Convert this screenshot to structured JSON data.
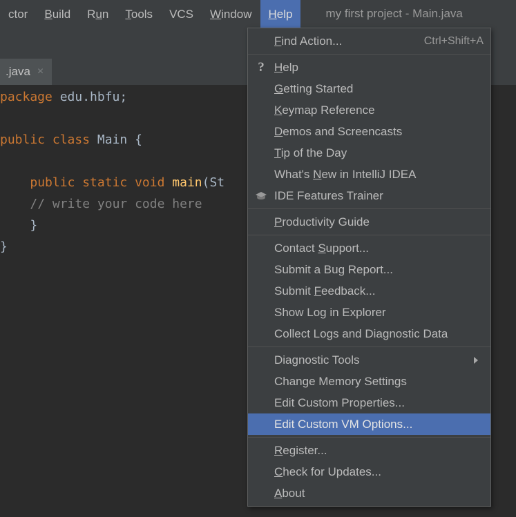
{
  "window": {
    "title": "my first project - Main.java"
  },
  "menubar": {
    "items": [
      {
        "label": "ctor",
        "mnemonic": "",
        "active": false
      },
      {
        "label": "Build",
        "mnemonic": "B",
        "active": false
      },
      {
        "label": "Run",
        "mnemonic": "u",
        "active": false
      },
      {
        "label": "Tools",
        "mnemonic": "T",
        "active": false
      },
      {
        "label": "VCS",
        "mnemonic": "",
        "active": false
      },
      {
        "label": "Window",
        "mnemonic": "W",
        "active": false
      },
      {
        "label": "Help",
        "mnemonic": "H",
        "active": true
      }
    ]
  },
  "editor": {
    "tab": {
      "label": ".java",
      "close_icon": "close-icon",
      "close_glyph": "×"
    },
    "code_lines": [
      [
        {
          "t": "package ",
          "c": "kw"
        },
        {
          "t": "edu.hbfu;",
          "c": "plain"
        }
      ],
      [],
      [
        {
          "t": "public class ",
          "c": "kw"
        },
        {
          "t": "Main {",
          "c": "plain"
        }
      ],
      [],
      [
        {
          "t": "    ",
          "c": "plain"
        },
        {
          "t": "public static void ",
          "c": "kw"
        },
        {
          "t": "main",
          "c": "mth"
        },
        {
          "t": "(St",
          "c": "plain"
        }
      ],
      [
        {
          "t": "    ",
          "c": "plain"
        },
        {
          "t": "// write your code here",
          "c": "cmt"
        }
      ],
      [
        {
          "t": "    }",
          "c": "plain"
        }
      ],
      [
        {
          "t": "}",
          "c": "plain"
        }
      ]
    ]
  },
  "help_menu": {
    "groups": [
      {
        "items": [
          {
            "label": "Find Action...",
            "mnemonic": "F",
            "accel": "Ctrl+Shift+A",
            "icon": "",
            "submenu": false,
            "selected": false
          }
        ]
      },
      {
        "items": [
          {
            "label": "Help",
            "mnemonic": "H",
            "accel": "",
            "icon": "question-mark-icon",
            "submenu": false,
            "selected": false
          },
          {
            "label": "Getting Started",
            "mnemonic": "G",
            "accel": "",
            "icon": "",
            "submenu": false,
            "selected": false
          },
          {
            "label": "Keymap Reference",
            "mnemonic": "K",
            "accel": "",
            "icon": "",
            "submenu": false,
            "selected": false
          },
          {
            "label": "Demos and Screencasts",
            "mnemonic": "D",
            "accel": "",
            "icon": "",
            "submenu": false,
            "selected": false
          },
          {
            "label": "Tip of the Day",
            "mnemonic": "T",
            "accel": "",
            "icon": "",
            "submenu": false,
            "selected": false
          },
          {
            "label": "What's New in IntelliJ IDEA",
            "mnemonic": "N",
            "accel": "",
            "icon": "",
            "submenu": false,
            "selected": false
          },
          {
            "label": "IDE Features Trainer",
            "mnemonic": "",
            "accel": "",
            "icon": "graduation-cap-icon",
            "submenu": false,
            "selected": false
          }
        ]
      },
      {
        "items": [
          {
            "label": "Productivity Guide",
            "mnemonic": "P",
            "accel": "",
            "icon": "",
            "submenu": false,
            "selected": false
          }
        ]
      },
      {
        "items": [
          {
            "label": "Contact Support...",
            "mnemonic": "S",
            "accel": "",
            "icon": "",
            "submenu": false,
            "selected": false
          },
          {
            "label": "Submit a Bug Report...",
            "mnemonic": "",
            "accel": "",
            "icon": "",
            "submenu": false,
            "selected": false
          },
          {
            "label": "Submit Feedback...",
            "mnemonic": "F",
            "accel": "",
            "icon": "",
            "submenu": false,
            "selected": false
          },
          {
            "label": "Show Log in Explorer",
            "mnemonic": "",
            "accel": "",
            "icon": "",
            "submenu": false,
            "selected": false
          },
          {
            "label": "Collect Logs and Diagnostic Data",
            "mnemonic": "",
            "accel": "",
            "icon": "",
            "submenu": false,
            "selected": false
          }
        ]
      },
      {
        "items": [
          {
            "label": "Diagnostic Tools",
            "mnemonic": "",
            "accel": "",
            "icon": "",
            "submenu": true,
            "selected": false
          },
          {
            "label": "Change Memory Settings",
            "mnemonic": "",
            "accel": "",
            "icon": "",
            "submenu": false,
            "selected": false
          },
          {
            "label": "Edit Custom Properties...",
            "mnemonic": "",
            "accel": "",
            "icon": "",
            "submenu": false,
            "selected": false
          },
          {
            "label": "Edit Custom VM Options...",
            "mnemonic": "",
            "accel": "",
            "icon": "",
            "submenu": false,
            "selected": true
          }
        ]
      },
      {
        "items": [
          {
            "label": "Register...",
            "mnemonic": "R",
            "accel": "",
            "icon": "",
            "submenu": false,
            "selected": false
          },
          {
            "label": "Check for Updates...",
            "mnemonic": "C",
            "accel": "",
            "icon": "",
            "submenu": false,
            "selected": false
          },
          {
            "label": "About",
            "mnemonic": "A",
            "accel": "",
            "icon": "",
            "submenu": false,
            "selected": false
          }
        ]
      }
    ]
  },
  "colors": {
    "menu_bg": "#3c3f41",
    "editor_bg": "#2b2b2b",
    "selection_blue": "#4b6eaf",
    "text": "#bbbbbb",
    "keyword_orange": "#cc7832",
    "comment_gray": "#808080",
    "method_yellow": "#ffc66d"
  }
}
